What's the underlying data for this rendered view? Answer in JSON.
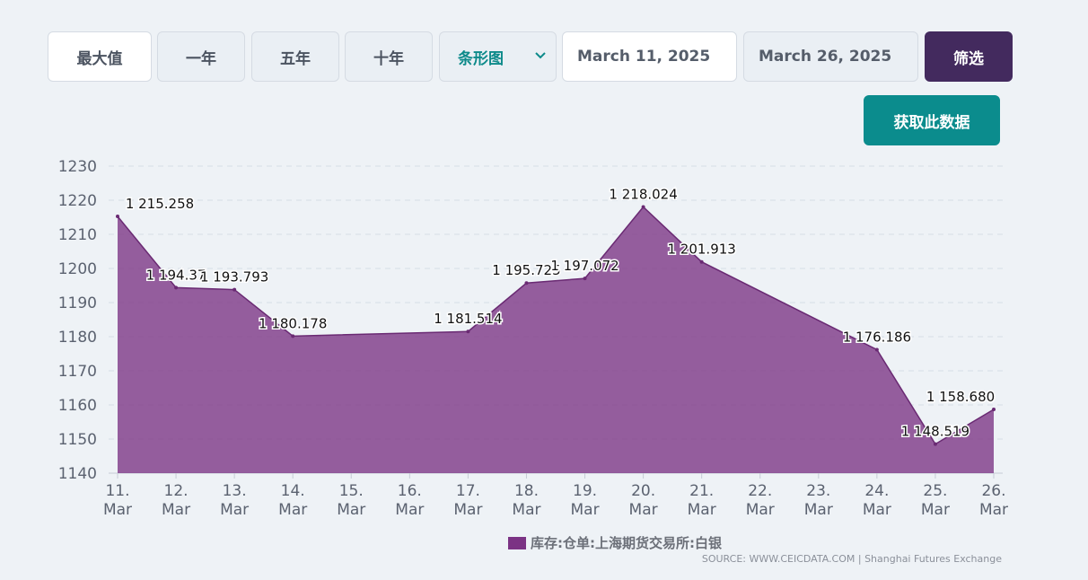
{
  "toolbar": {
    "range_buttons": [
      "最大值",
      "一年",
      "五年",
      "十年"
    ],
    "chart_type_select": "条形图",
    "start_date": "March 11, 2025",
    "end_date": "March 26, 2025",
    "filter_label": "筛选",
    "get_data_label": "获取此数据"
  },
  "colors": {
    "series_fill": "#7b3384",
    "filter_button": "#432a5e",
    "get_data_button": "#0b8c8d",
    "select_text": "#0d8a8a"
  },
  "chart_data": {
    "type": "area",
    "categories": [
      "11.\nMar",
      "12.\nMar",
      "13.\nMar",
      "14.\nMar",
      "15.\nMar",
      "16.\nMar",
      "17.\nMar",
      "18.\nMar",
      "19.\nMar",
      "20.\nMar",
      "21.\nMar",
      "22.\nMar",
      "23.\nMar",
      "24.\nMar",
      "25.\nMar",
      "26.\nMar"
    ],
    "series": [
      {
        "name": "库存:仓单:上海期货交易所:白银",
        "points": [
          {
            "x": "11. Mar",
            "y": 1215.258,
            "label": "1 215.258"
          },
          {
            "x": "12. Mar",
            "y": 1194.37,
            "label": "1 194.37"
          },
          {
            "x": "13. Mar",
            "y": 1193.793,
            "label": "1 193.793"
          },
          {
            "x": "14. Mar",
            "y": 1180.178,
            "label": "1 180.178"
          },
          {
            "x": "17. Mar",
            "y": 1181.514,
            "label": "1 181.514"
          },
          {
            "x": "18. Mar",
            "y": 1195.725,
            "label": "1 195.725"
          },
          {
            "x": "19. Mar",
            "y": 1197.072,
            "label": "1 197.072"
          },
          {
            "x": "20. Mar",
            "y": 1218.024,
            "label": "1 218.024"
          },
          {
            "x": "21. Mar",
            "y": 1201.913,
            "label": "1 201.913"
          },
          {
            "x": "24. Mar",
            "y": 1176.186,
            "label": "1 176.186"
          },
          {
            "x": "25. Mar",
            "y": 1148.519,
            "label": "1 148.519"
          },
          {
            "x": "26. Mar",
            "y": 1158.68,
            "label": "1 158.680"
          }
        ]
      }
    ],
    "yticks": [
      "1140",
      "1150",
      "1160",
      "1170",
      "1180",
      "1190",
      "1200",
      "1210",
      "1220",
      "1230"
    ],
    "ylim": [
      1140,
      1230
    ],
    "grid": true,
    "legend": "bottom-center",
    "source": "SOURCE: WWW.CEICDATA.COM | Shanghai Futures Exchange"
  }
}
